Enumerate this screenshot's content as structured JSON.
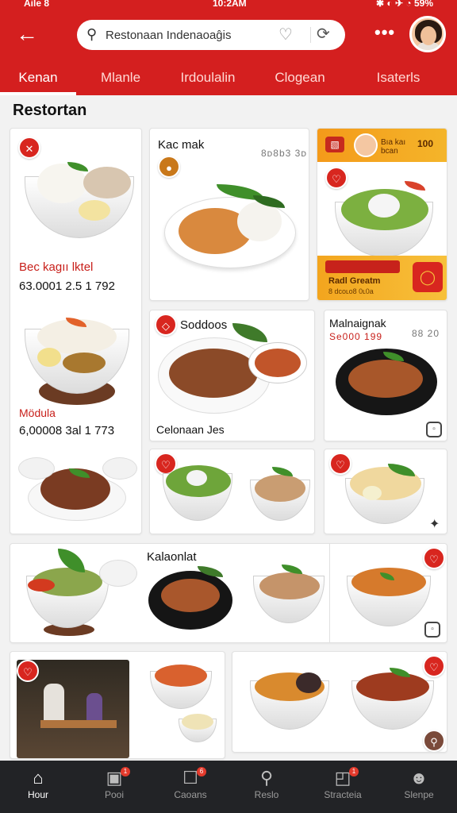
{
  "status": {
    "left": "Aile 8",
    "time": "10:2AM",
    "right": "✱ ◐ ✈ ◔ 59%"
  },
  "header": {
    "search_value": "Restonaan Indenaoaĝis",
    "tabs": [
      {
        "label": "Kenan",
        "active": true
      },
      {
        "label": "Mlanle",
        "active": false
      },
      {
        "label": "Irdoulalin",
        "active": false
      },
      {
        "label": "Clogean",
        "active": false
      },
      {
        "label": "Isaterls",
        "active": false
      }
    ]
  },
  "section_title": "Restortan",
  "cards": {
    "c1": {
      "title": "Bec kagıı lktel",
      "price": "63.0001 2.5 1 792",
      "title2": "Mödula",
      "price2": "6,00008 3al 1 773"
    },
    "c2": {
      "title": "Kac mak",
      "sub": "8ᴅ8b3 3ᴅ"
    },
    "c3": {
      "head_text": "Bıa kaı bcan",
      "head_num": "100",
      "foot_title": "Radl Greatm",
      "foot_sub": "8 dcoʟo8 0ʟ0a"
    },
    "c4": {
      "title": "Soddoos",
      "caption": "Celonaan Jes"
    },
    "c5": {
      "title": "Malnaignak",
      "sub": "Se000 199",
      "sub2": "88 20"
    },
    "c9": {
      "title": "Kalaonlat"
    }
  },
  "nav": [
    {
      "label": "Hour",
      "icon": "home-icon",
      "active": true,
      "badge": ""
    },
    {
      "label": "Pooi",
      "icon": "chat-icon",
      "active": false,
      "badge": "1"
    },
    {
      "label": "Caoans",
      "icon": "cart-icon",
      "active": false,
      "badge": "6"
    },
    {
      "label": "Reslo",
      "icon": "search-icon",
      "active": false,
      "badge": ""
    },
    {
      "label": "Stracteia",
      "icon": "bag-icon",
      "active": false,
      "badge": "1"
    },
    {
      "label": "Slenpe",
      "icon": "profile-icon",
      "active": false,
      "badge": ""
    }
  ],
  "colors": {
    "brand": "#d41f1f",
    "accent": "#f49a1a",
    "nav_bg": "#222326"
  }
}
